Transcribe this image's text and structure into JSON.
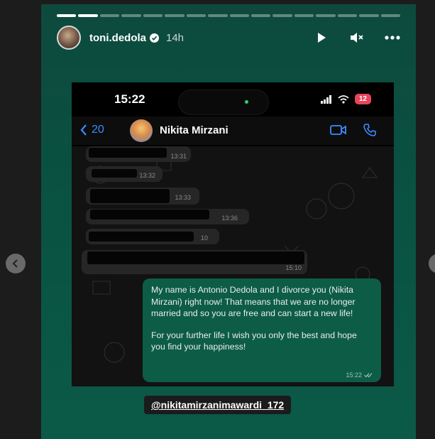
{
  "story": {
    "username": "toni.dedola",
    "time_ago": "14h",
    "mention_tag": "@nikitamirzanimawardi_172",
    "progress_segments": 16,
    "progress_done": 2
  },
  "phone": {
    "clock": "15:22",
    "battery": "12"
  },
  "chat": {
    "back_count": "20",
    "contact_name": "Nikita Mirzani",
    "incoming": [
      {
        "time": "13:31"
      },
      {
        "time": "13:32"
      },
      {
        "time": "13:33"
      },
      {
        "time": "13:36"
      },
      {
        "time": "10"
      },
      {
        "time": "15:10"
      }
    ],
    "outgoing": {
      "paragraph1": "My name is Antonio Dedola and I divorce you (Nikita Mirzani) right now! That means that we are no longer married and so you are free and can start a new life!",
      "paragraph2": "For your further life I wish you only the best and hope you find your happiness!",
      "time": "15:22"
    }
  },
  "colors": {
    "story_bg": "#0b4d3f",
    "out_bubble": "#0d5c46",
    "accent_blue": "#3a8cff",
    "battery_red": "#e9445a"
  },
  "icons": [
    "verified-badge-icon",
    "play-icon",
    "mute-icon",
    "more-icon",
    "chevron-left-icon",
    "video-call-icon",
    "phone-call-icon",
    "wifi-icon",
    "signal-icon",
    "double-check-icon"
  ]
}
